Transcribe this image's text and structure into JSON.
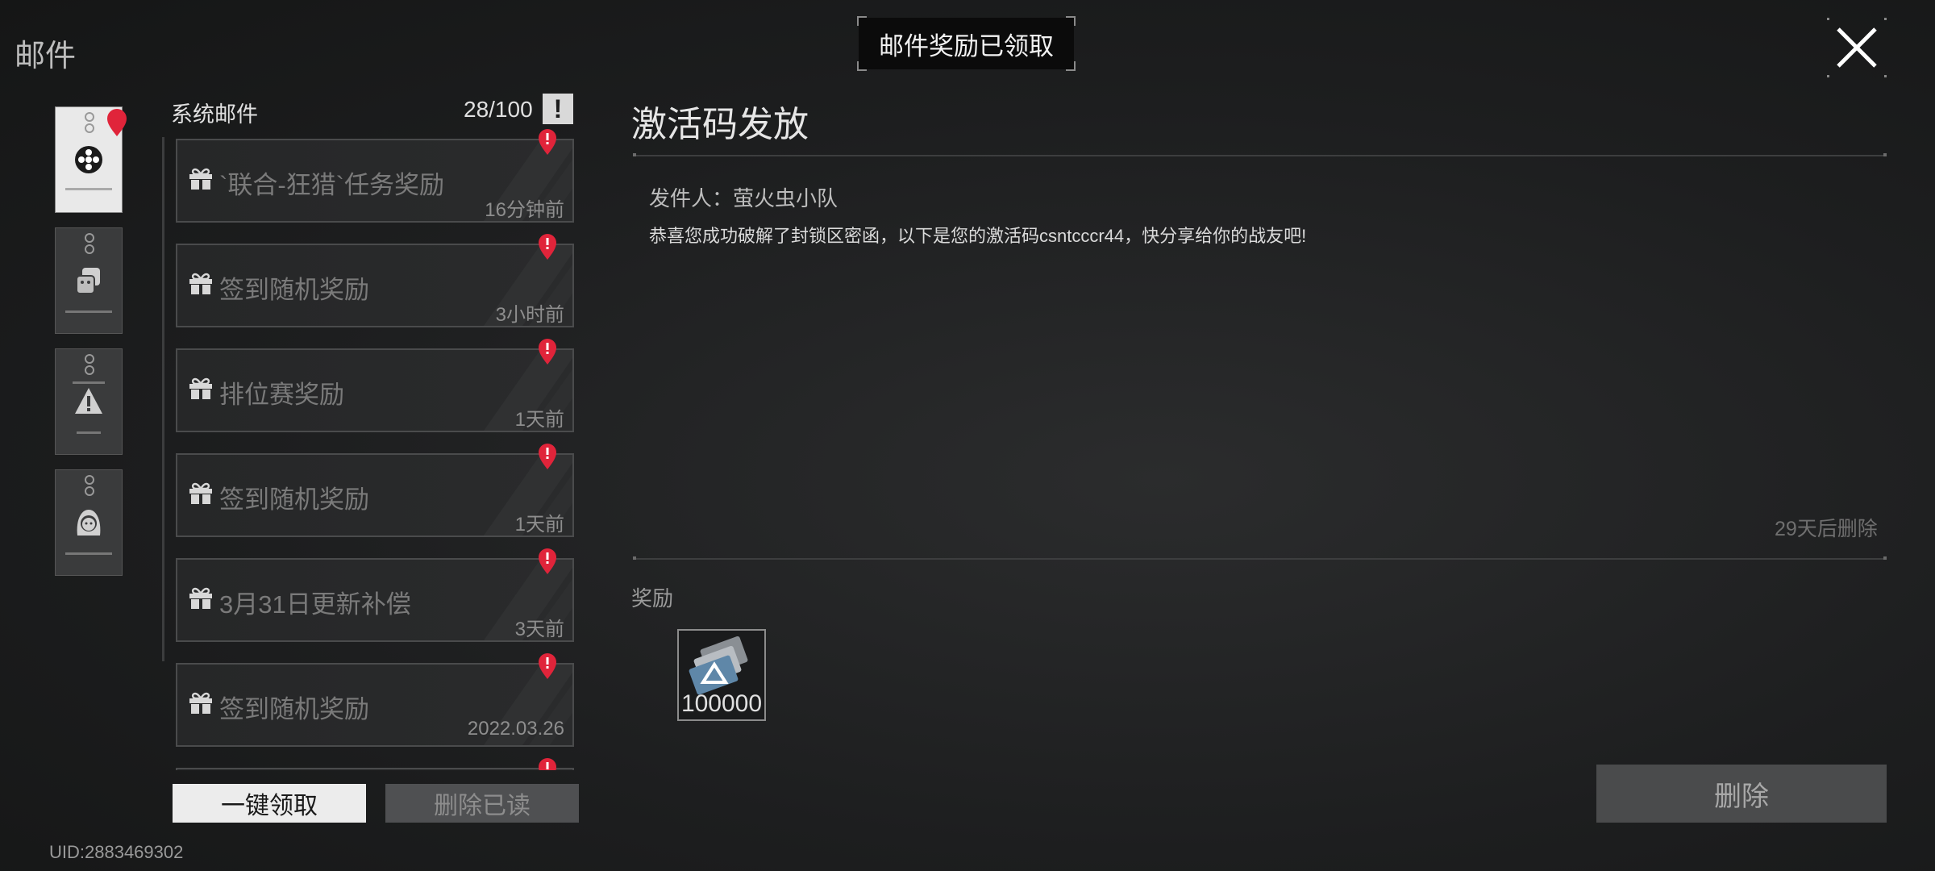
{
  "header": {
    "title": "邮件",
    "toast": "邮件奖励已领取"
  },
  "categories": [
    {
      "name": "system",
      "active": true,
      "badge": true
    },
    {
      "name": "activity",
      "active": false
    },
    {
      "name": "notice",
      "active": false
    },
    {
      "name": "friend",
      "active": false
    }
  ],
  "list": {
    "title": "系统邮件",
    "count": "28/100",
    "info_glyph": "!",
    "items": [
      {
        "subject": "`联合-狂猎`任务奖励",
        "time": "16分钟前",
        "unread": true
      },
      {
        "subject": "签到随机奖励",
        "time": "3小时前",
        "unread": true
      },
      {
        "subject": "排位赛奖励",
        "time": "1天前",
        "unread": true
      },
      {
        "subject": "签到随机奖励",
        "time": "1天前",
        "unread": true
      },
      {
        "subject": "3月31日更新补偿",
        "time": "3天前",
        "unread": true
      },
      {
        "subject": "签到随机奖励",
        "time": "2022.03.26",
        "unread": true
      },
      {
        "subject": "",
        "time": "",
        "unread": true
      }
    ],
    "claim_all_label": "一键领取",
    "delete_read_label": "删除已读"
  },
  "uid": "UID:2883469302",
  "detail": {
    "title": "激活码发放",
    "sender": "发件人：萤火虫小队",
    "body": "恭喜您成功破解了封锁区密函，以下是您的激活码csntcccr44，快分享给你的战友吧!",
    "expire": "29天后删除",
    "rewards_label": "奖励",
    "rewards": [
      {
        "icon": "currency-icon",
        "quantity": "100000"
      }
    ],
    "delete_label": "删除"
  },
  "colors": {
    "unread_badge": "#e0243a",
    "background": "#1d1e1f",
    "primary_button": "#ececec"
  }
}
